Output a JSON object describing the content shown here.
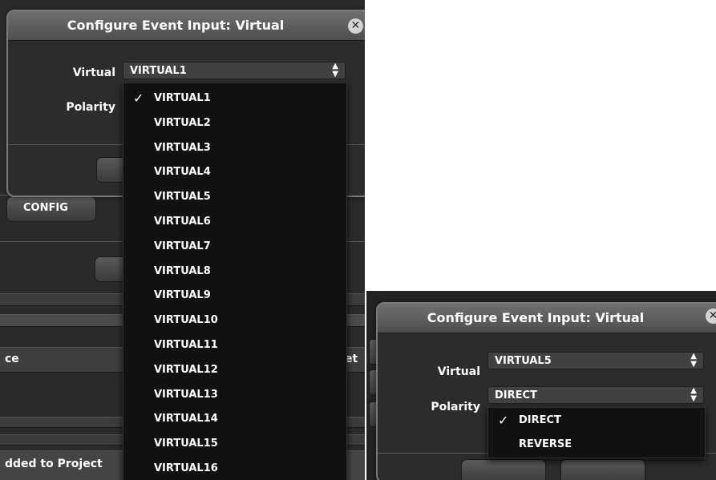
{
  "left": {
    "dialog_title": "Configure Event Input: Virtual",
    "virtual_label": "Virtual",
    "polarity_label": "Polarity",
    "virtual_value": "VIRTUAL1",
    "config_button": "CONFIG",
    "bg_column_left": "ce",
    "bg_column_right": "et",
    "bg_added_text": "dded to Project",
    "dropdown_options": [
      "VIRTUAL1",
      "VIRTUAL2",
      "VIRTUAL3",
      "VIRTUAL4",
      "VIRTUAL5",
      "VIRTUAL6",
      "VIRTUAL7",
      "VIRTUAL8",
      "VIRTUAL9",
      "VIRTUAL10",
      "VIRTUAL11",
      "VIRTUAL12",
      "VIRTUAL13",
      "VIRTUAL14",
      "VIRTUAL15",
      "VIRTUAL16"
    ],
    "dropdown_selected": "VIRTUAL1"
  },
  "right": {
    "dialog_title": "Configure Event Input: Virtual",
    "virtual_label": "Virtual",
    "polarity_label": "Polarity",
    "virtual_value": "VIRTUAL5",
    "polarity_value": "DIRECT",
    "dropdown_options": [
      "DIRECT",
      "REVERSE"
    ],
    "dropdown_selected": "DIRECT"
  },
  "icons": {
    "close": "close-icon",
    "checkmark": "check-icon",
    "select_arrows": "updown-arrows-icon"
  },
  "colors": {
    "dialog_bg": "#2c2c2c",
    "dropdown_bg": "#111111",
    "title_bar": "#5e5e5e"
  }
}
